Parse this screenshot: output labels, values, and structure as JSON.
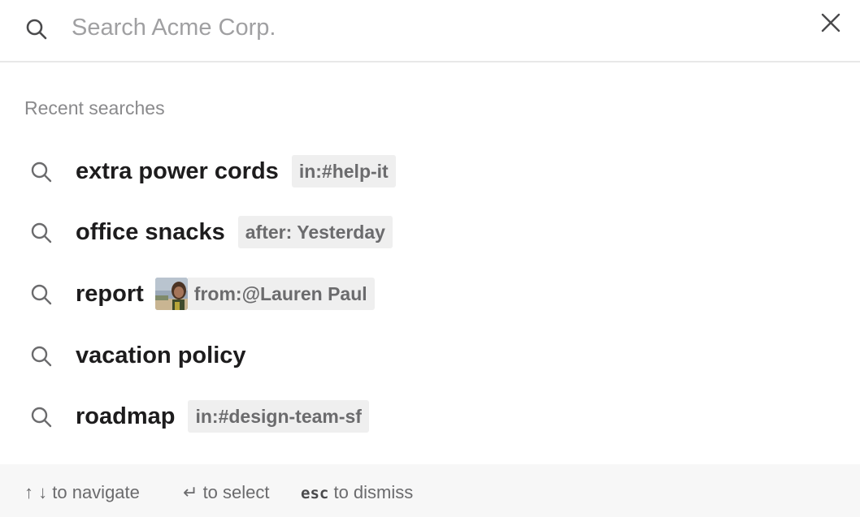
{
  "search": {
    "placeholder": "Search Acme Corp."
  },
  "recent": {
    "label": "Recent searches",
    "items": [
      {
        "query": "extra power cords",
        "modifier": "in:#help-it"
      },
      {
        "query": "office snacks",
        "modifier": "after: Yesterday"
      },
      {
        "query": "report",
        "modifier": "from:@Lauren Paul",
        "avatar": "user-avatar"
      },
      {
        "query": "vacation policy"
      },
      {
        "query": "roadmap",
        "modifier": "in:#design-team-sf"
      }
    ]
  },
  "footer": {
    "navigate_keys": "↑ ↓",
    "navigate_text": "to navigate",
    "select_key": "↵",
    "select_text": "to select",
    "dismiss_key": "esc",
    "dismiss_text": "to dismiss"
  },
  "icons": {
    "search": "search-icon",
    "close": "close-icon"
  }
}
